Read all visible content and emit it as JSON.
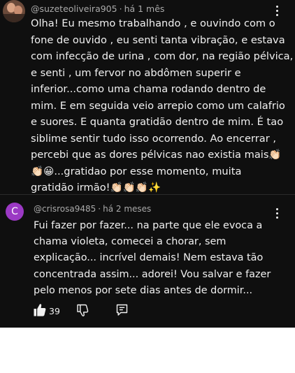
{
  "comments": [
    {
      "username": "@suzeteoliveira905",
      "time": "há 1 mês",
      "lines": [
        "Olha! Eu mesmo trabalhando , e ouvindo com o",
        "fone de ouvido , eu senti tanta vibração, e estava",
        "com infecção de urina , com dor, na região pélvica,",
        "e senti , um fervor no abdômen superir e",
        "inferior...como uma chama rodando dentro de",
        "mim. E em seguida veio arrepio como um calafrio",
        "e suores. E quanta gratidão dentro de mim. É tao",
        "siblime sentir tudo isso ocorrendo. Ao encerrar ,",
        "percebi que as dores pélvicas nao existia mais👏🏻",
        "👏🏻😀...gratidao por esse momento, muita",
        "gratidão irmão!👏🏻👏🏻👏🏻✨"
      ]
    },
    {
      "avatar_letter": "C",
      "username": "@crisrosa9485",
      "time": "há 2 meses",
      "lines": [
        "Fui fazer por fazer... na parte que ele evoca a",
        "chama violeta, comecei a chorar,  sem",
        "explicação... incrível demais! Nem estava tão",
        "concentrada assim... adorei! Vou salvar e fazer",
        "pelo menos por sete dias antes de dormir..."
      ],
      "actions": {
        "like_count": "39",
        "like_icon": "thumbs-up-icon",
        "dislike_icon": "thumbs-down-icon",
        "reply_icon": "reply-icon"
      }
    }
  ],
  "colors": {
    "background": "#0f0f0f",
    "text": "#f1f1f1",
    "meta": "#aaaaaa",
    "avatar_c": "#9b39c4"
  }
}
